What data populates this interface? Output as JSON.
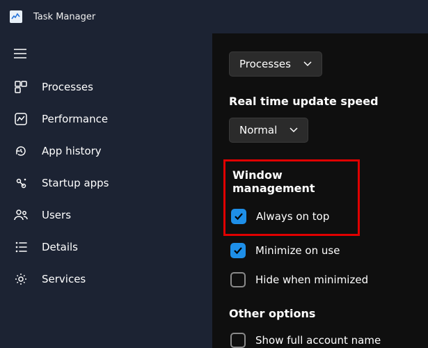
{
  "app": {
    "title": "Task Manager"
  },
  "sidebar": {
    "items": [
      {
        "label": "Processes"
      },
      {
        "label": "Performance"
      },
      {
        "label": "App history"
      },
      {
        "label": "Startup apps"
      },
      {
        "label": "Users"
      },
      {
        "label": "Details"
      },
      {
        "label": "Services"
      }
    ]
  },
  "settings": {
    "default_page": {
      "value": "Processes"
    },
    "update_speed": {
      "title": "Real time update speed",
      "value": "Normal"
    },
    "window_mgmt": {
      "title": "Window management",
      "always_on_top": {
        "label": "Always on top",
        "checked": true
      },
      "minimize_on_use": {
        "label": "Minimize on use",
        "checked": true
      },
      "hide_when_minimized": {
        "label": "Hide when minimized",
        "checked": false
      }
    },
    "other": {
      "title": "Other options",
      "show_full_account": {
        "label": "Show full account name",
        "checked": false
      }
    }
  }
}
